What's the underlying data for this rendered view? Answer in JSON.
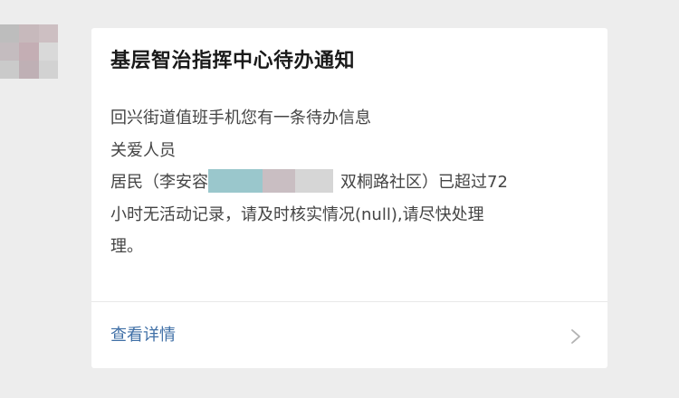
{
  "avatar": {
    "icon": "user-avatar",
    "pixel_colors": [
      "#bdbdbd",
      "#c7b9bc",
      "#cdbfc2",
      "#c4bcbf",
      "#c4aeb4",
      "#d9d9d9",
      "#cacaca",
      "#bfb0b5",
      "#d2d2d2"
    ]
  },
  "card": {
    "title": "基层智治指挥中心待办通知",
    "body": {
      "line1": "回兴街道值班手机您有一条待办信息",
      "line2": "关爱人员",
      "line3_before": "居民（李安容",
      "line3_after": "双桐路社区）已超过72",
      "line4": "小时无活动记录，请及时核实情况(null),请尽快处理",
      "line5": "理。"
    },
    "redaction_colors": [
      "#9ac7cc",
      "#c9bec2",
      "#d6d6d6"
    ],
    "footer": {
      "link_label": "查看详情",
      "chevron_icon": "chevron-right-icon"
    }
  },
  "colors": {
    "background": "#ededed",
    "card": "#ffffff",
    "link": "#3f6fa6",
    "title": "#1a1a1a",
    "body_text": "#444444"
  }
}
